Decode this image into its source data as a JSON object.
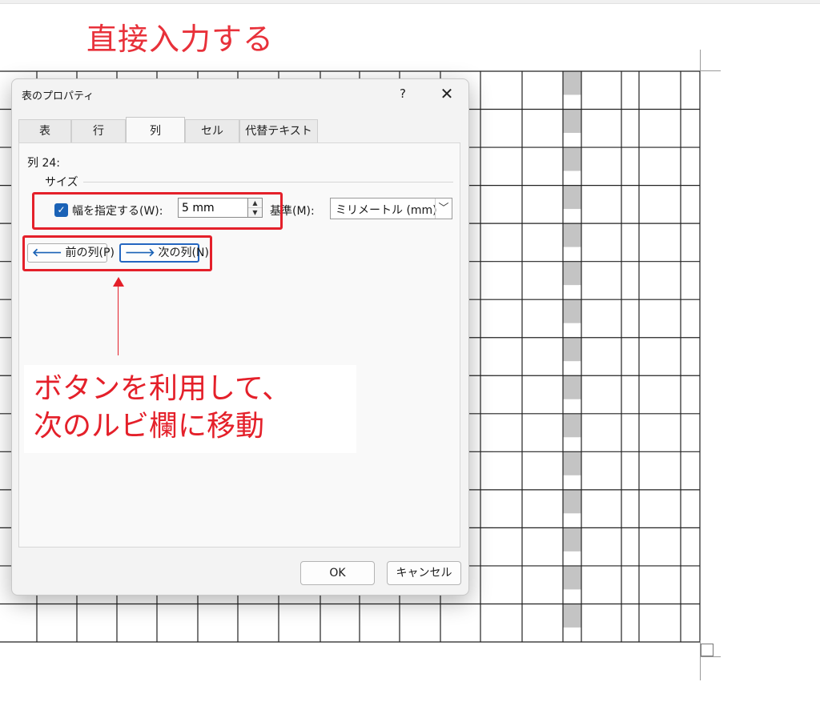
{
  "annotation": {
    "heading": "直接入力する",
    "callout_line1": "ボタンを利用して、",
    "callout_line2": "次のルビ欄に移動"
  },
  "dialog": {
    "title": "表のプロパティ",
    "help": "?",
    "close": "✕",
    "tabs": [
      "表",
      "行",
      "列",
      "セル",
      "代替テキスト"
    ],
    "active_tab": "列",
    "column_label": "列 24:",
    "size_group": "サイズ",
    "width_checkbox_label": "幅を指定する(W):",
    "width_checked": true,
    "width_value": "5 mm",
    "unit_label": "基準(M):",
    "unit_value": "ミリメートル (mm)",
    "prev_column": "前の列(P)",
    "next_column": "次の列(N)",
    "ok": "OK",
    "cancel": "キャンセル"
  },
  "colors": {
    "annotation_red": "#e4202a",
    "accent_blue": "#1a62b6",
    "ruby_cell_gray": "#c4c4c4"
  }
}
